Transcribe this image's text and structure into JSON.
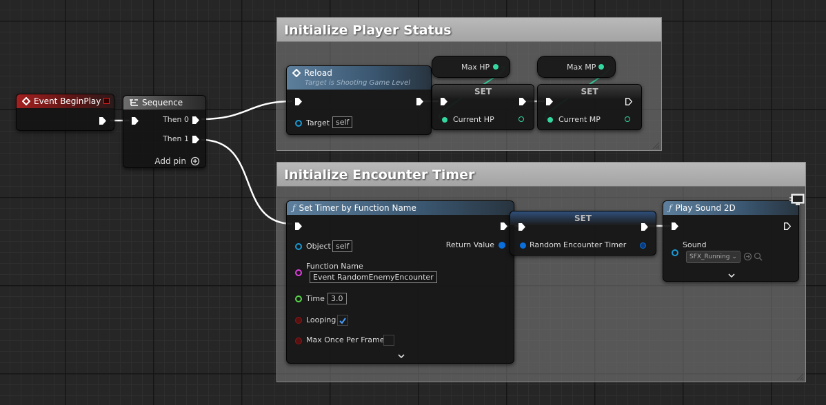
{
  "comments": {
    "player_status": "Initialize Player Status",
    "encounter_timer": "Initialize Encounter Timer"
  },
  "event_begin_play": {
    "title": "Event BeginPlay",
    "accent": "#a32020"
  },
  "sequence": {
    "title": "Sequence",
    "then0": "Then 0",
    "then1": "Then 1",
    "add_pin": "Add pin"
  },
  "reload": {
    "title": "Reload",
    "subtitle": "Target is Shooting Game Level",
    "target_label": "Target",
    "target_value": "self"
  },
  "max_hp": {
    "label": "Max HP"
  },
  "max_mp": {
    "label": "Max MP"
  },
  "set_hp": {
    "title": "SET",
    "var_label": "Current HP"
  },
  "set_mp": {
    "title": "SET",
    "var_label": "Current MP"
  },
  "set_timer": {
    "title": "Set Timer by Function Name",
    "object_label": "Object",
    "object_value": "self",
    "return_label": "Return Value",
    "function_label": "Function Name",
    "function_value": "Event RandomEnemyEncounter",
    "time_label": "Time",
    "time_value": "3.0",
    "looping_label": "Looping",
    "looping_checked": true,
    "max_once_label": "Max Once Per Frame",
    "max_once_checked": false
  },
  "set_timer_var": {
    "title": "SET",
    "var_label": "Random Encounter Timer"
  },
  "play_sound": {
    "title": "Play Sound 2D",
    "sound_label": "Sound",
    "sound_value": "SFX_Running"
  },
  "colors": {
    "exec": "#ffffff",
    "float_pin": "#35d7a0",
    "object_pin": "#0a6edb",
    "string_pin": "#e040e0",
    "time_pin": "#58d64a",
    "bool_pin": "#8a1a1a",
    "wire_float": "#35d7a0"
  }
}
